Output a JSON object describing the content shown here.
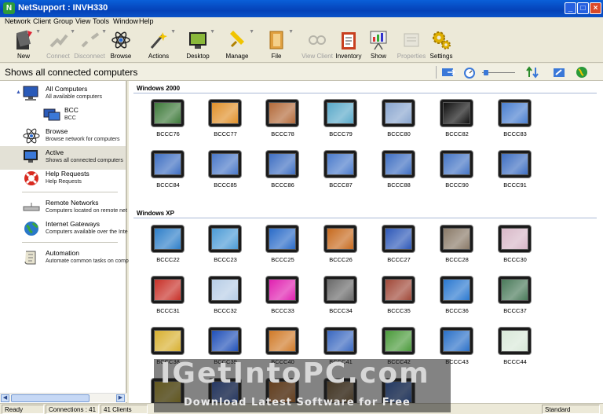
{
  "window": {
    "title": "NetSupport : INVH330",
    "app_icon": "netsupport-icon"
  },
  "title_buttons": [
    "_",
    "□",
    "×"
  ],
  "menu": [
    "Network",
    "Client",
    "Group",
    "View",
    "Tools",
    "Window",
    "Help"
  ],
  "toolbar": [
    {
      "label": "New",
      "icon": "new-icon",
      "enabled": true
    },
    {
      "label": "Connect",
      "icon": "connect-icon",
      "enabled": false
    },
    {
      "label": "Disconnect",
      "icon": "disconnect-icon",
      "enabled": false
    },
    {
      "label": "Browse",
      "icon": "browse-icon",
      "enabled": true
    },
    {
      "label": "Actions",
      "icon": "actions-icon",
      "enabled": true
    },
    {
      "label": "Desktop",
      "icon": "desktop-icon",
      "enabled": true
    },
    {
      "label": "Manage",
      "icon": "manage-icon",
      "enabled": true
    },
    {
      "label": "File",
      "icon": "file-icon",
      "enabled": true
    },
    {
      "label": "View Client",
      "icon": "view-client-icon",
      "enabled": false
    },
    {
      "label": "Inventory",
      "icon": "inventory-icon",
      "enabled": true
    },
    {
      "label": "Show",
      "icon": "show-icon",
      "enabled": true
    },
    {
      "label": "Properties",
      "icon": "properties-icon",
      "enabled": false
    },
    {
      "label": "Settings",
      "icon": "settings-icon",
      "enabled": true
    }
  ],
  "header": {
    "title": "Shows all connected computers"
  },
  "left_pane": {
    "items": [
      {
        "title": "All Computers",
        "subtitle": "All available computers",
        "icon": "computers-icon",
        "selected": false
      },
      {
        "title": "BCC",
        "subtitle": "BCC",
        "icon": "group-icon",
        "selected": false
      },
      {
        "title": "Browse",
        "subtitle": "Browse network for computers",
        "icon": "browse-icon",
        "selected": false
      },
      {
        "title": "Active",
        "subtitle": "Shows all connected computers",
        "icon": "active-monitor-icon",
        "selected": true
      },
      {
        "title": "Help Requests",
        "subtitle": "Help Requests",
        "icon": "lifebuoy-icon",
        "selected": false
      },
      {
        "title": "Remote Networks",
        "subtitle": "Computers located on remote net",
        "icon": "remote-network-icon",
        "selected": false
      },
      {
        "title": "Internet Gateways",
        "subtitle": "Computers available over the Inte",
        "icon": "globe-icon",
        "selected": false
      },
      {
        "title": "Automation",
        "subtitle": "Automate common tasks on comp",
        "icon": "scroll-icon",
        "selected": false
      }
    ]
  },
  "groups": [
    {
      "name": "Windows 2000",
      "clients": [
        {
          "name": "BCCC76",
          "screen": "#3e7a3a"
        },
        {
          "name": "BCCC77",
          "screen": "#e0902a"
        },
        {
          "name": "BCCC78",
          "screen": "#b36a3a"
        },
        {
          "name": "BCCC79",
          "screen": "#5aa9c9"
        },
        {
          "name": "BCCC80",
          "screen": "#8aa6cf"
        },
        {
          "name": "BCCC82",
          "screen": "#111111"
        },
        {
          "name": "BCCC83",
          "screen": "#4a7fd0"
        },
        {
          "name": "BCCC84",
          "screen": "#3f6fc2"
        },
        {
          "name": "BCCC85",
          "screen": "#4a78c8"
        },
        {
          "name": "BCCC86",
          "screen": "#3f6fc2"
        },
        {
          "name": "BCCC87",
          "screen": "#4b7bcb"
        },
        {
          "name": "BCCC88",
          "screen": "#3f6fc2"
        },
        {
          "name": "BCCC90",
          "screen": "#4575c5"
        },
        {
          "name": "BCCC91",
          "screen": "#3f6fc2"
        }
      ]
    },
    {
      "name": "Windows XP",
      "clients": [
        {
          "name": "BCCC22",
          "screen": "#2e7fc9"
        },
        {
          "name": "BCCC23",
          "screen": "#4c9bd6"
        },
        {
          "name": "BCCC25",
          "screen": "#2a6bc8"
        },
        {
          "name": "BCCC26",
          "screen": "#c76a1e"
        },
        {
          "name": "BCCC27",
          "screen": "#2d58b8"
        },
        {
          "name": "BCCC28",
          "screen": "#8a7a68"
        },
        {
          "name": "BCCC30",
          "screen": "#d8b8c8"
        },
        {
          "name": "BCCC31",
          "screen": "#c83028"
        },
        {
          "name": "BCCC32",
          "screen": "#b7cde6"
        },
        {
          "name": "BCCC33",
          "screen": "#e020b0"
        },
        {
          "name": "BCCC34",
          "screen": "#6a6a6a"
        },
        {
          "name": "BCCC35",
          "screen": "#a04838"
        },
        {
          "name": "BCCC36",
          "screen": "#2a78d0"
        },
        {
          "name": "BCCC37",
          "screen": "#4a7a5a"
        },
        {
          "name": "BCCC38",
          "screen": "#d8b030"
        },
        {
          "name": "BCCC39",
          "screen": "#2050b8"
        },
        {
          "name": "BCCC40",
          "screen": "#d07a28"
        },
        {
          "name": "BCCC41",
          "screen": "#3a68c0"
        },
        {
          "name": "BCCC42",
          "screen": "#4a9a3a"
        },
        {
          "name": "BCCC43",
          "screen": "#2a70c8"
        },
        {
          "name": "BCCC44",
          "screen": "#d8e8d8"
        },
        {
          "name": "",
          "screen": "#b8a020"
        },
        {
          "name": "",
          "screen": "#3058b8"
        },
        {
          "name": "",
          "screen": "#c06a20"
        },
        {
          "name": "",
          "screen": "#7a5a30"
        },
        {
          "name": "",
          "screen": "#2a5ab8"
        }
      ]
    }
  ],
  "status": {
    "ready": "Ready",
    "connections": "Connections : 41",
    "clients": "41 Clients",
    "mode": "Standard"
  },
  "watermark": {
    "big": "IGetIntoPC.com",
    "small": "Download Latest Software for Free"
  }
}
